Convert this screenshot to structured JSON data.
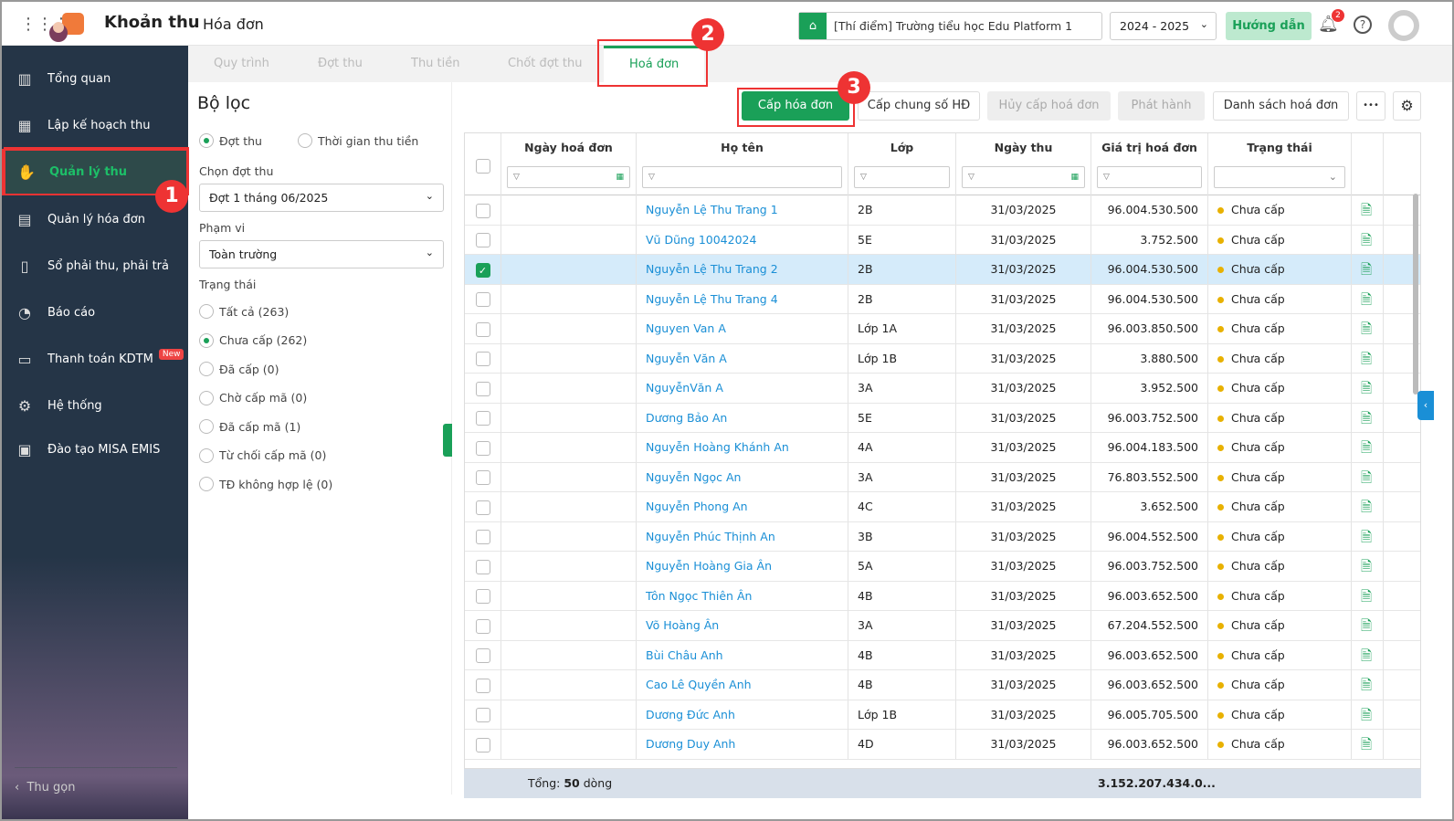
{
  "header": {
    "app_title": "Khoản thu",
    "page_title": "Hóa đơn",
    "school": "[Thí điểm] Trường tiểu học Edu Platform 1",
    "year": "2024 - 2025",
    "guide": "Hướng dẫn",
    "notif_count": "2",
    "help": "?"
  },
  "sidebar": {
    "items": [
      {
        "label": "Tổng quan",
        "icon": "chart-icon"
      },
      {
        "label": "Lập kế hoạch thu",
        "icon": "calendar-dollar-icon"
      },
      {
        "label": "Quản lý thu",
        "icon": "money-hand-icon",
        "active": true
      },
      {
        "label": "Quản lý hóa đơn",
        "icon": "invoice-icon"
      },
      {
        "label": "Sổ phải thu, phải trả",
        "icon": "ledger-icon"
      },
      {
        "label": "Báo cáo",
        "icon": "pie-chart-icon"
      },
      {
        "label": "Thanh toán KDTM",
        "icon": "card-icon",
        "badge": "New"
      },
      {
        "label": "Hệ thống",
        "icon": "gear-icon"
      },
      {
        "label": "Đào tạo MISA EMIS",
        "icon": "book-icon"
      }
    ],
    "collapse": "Thu gọn"
  },
  "callouts": [
    "1",
    "2",
    "3"
  ],
  "tabs": [
    "Quy trình",
    "Đợt thu",
    "Thu tiền",
    "Chốt đợt thu",
    "Hoá đơn"
  ],
  "filter": {
    "title": "Bộ lọc",
    "mode_options": [
      "Đợt thu",
      "Thời gian thu tiền"
    ],
    "period_label": "Chọn đợt thu",
    "period_value": "Đợt 1 tháng 06/2025",
    "scope_label": "Phạm vi",
    "scope_value": "Toàn trường",
    "status_label": "Trạng thái",
    "status_options": [
      "Tất cả (263)",
      "Chưa cấp (262)",
      "Đã cấp (0)",
      "Chờ cấp mã (0)",
      "Đã cấp mã (1)",
      "Từ chối cấp mã (0)",
      "TĐ không hợp lệ (0)"
    ],
    "status_selected": 1
  },
  "toolbar": {
    "issue": "Cấp hóa đơn",
    "issue_common": "Cấp chung số HĐ",
    "cancel": "Hủy cấp hoá đơn",
    "publish": "Phát hành",
    "list": "Danh sách hoá đơn",
    "more": "•••",
    "settings": "⚙"
  },
  "table": {
    "columns": [
      "Ngày hoá đơn",
      "Họ tên",
      "Lớp",
      "Ngày thu",
      "Giá trị hoá đơn",
      "Trạng thái"
    ],
    "rows": [
      [
        "",
        "Nguyễn Lệ Thu Trang 1",
        "2B",
        "31/03/2025",
        "96.004.530.500",
        "Chưa cấp"
      ],
      [
        "",
        "Vũ Dũng 10042024",
        "5E",
        "31/03/2025",
        "3.752.500",
        "Chưa cấp"
      ],
      [
        "",
        "Nguyễn Lệ Thu Trang 2",
        "2B",
        "31/03/2025",
        "96.004.530.500",
        "Chưa cấp"
      ],
      [
        "",
        "Nguyễn Lệ Thu Trang 4",
        "2B",
        "31/03/2025",
        "96.004.530.500",
        "Chưa cấp"
      ],
      [
        "",
        "Nguyen Van A",
        "Lớp 1A",
        "31/03/2025",
        "96.003.850.500",
        "Chưa cấp"
      ],
      [
        "",
        "Nguyễn Văn A",
        "Lớp 1B",
        "31/03/2025",
        "3.880.500",
        "Chưa cấp"
      ],
      [
        "",
        "NguyễnVăn A",
        "3A",
        "31/03/2025",
        "3.952.500",
        "Chưa cấp"
      ],
      [
        "",
        "Dương Bảo An",
        "5E",
        "31/03/2025",
        "96.003.752.500",
        "Chưa cấp"
      ],
      [
        "",
        "Nguyễn Hoàng Khánh An",
        "4A",
        "31/03/2025",
        "96.004.183.500",
        "Chưa cấp"
      ],
      [
        "",
        "Nguyễn Ngọc An",
        "3A",
        "31/03/2025",
        "76.803.552.500",
        "Chưa cấp"
      ],
      [
        "",
        "Nguyễn Phong An",
        "4C",
        "31/03/2025",
        "3.652.500",
        "Chưa cấp"
      ],
      [
        "",
        "Nguyễn Phúc Thịnh An",
        "3B",
        "31/03/2025",
        "96.004.552.500",
        "Chưa cấp"
      ],
      [
        "",
        "Nguyễn Hoàng Gia Ân",
        "5A",
        "31/03/2025",
        "96.003.752.500",
        "Chưa cấp"
      ],
      [
        "",
        "Tôn Ngọc Thiên Ân",
        "4B",
        "31/03/2025",
        "96.003.652.500",
        "Chưa cấp"
      ],
      [
        "",
        "Võ Hoàng Ân",
        "3A",
        "31/03/2025",
        "67.204.552.500",
        "Chưa cấp"
      ],
      [
        "",
        "Bùi Châu Anh",
        "4B",
        "31/03/2025",
        "96.003.652.500",
        "Chưa cấp"
      ],
      [
        "",
        "Cao Lê Quyền Anh",
        "4B",
        "31/03/2025",
        "96.003.652.500",
        "Chưa cấp"
      ],
      [
        "",
        "Dương Đức Anh",
        "Lớp 1B",
        "31/03/2025",
        "96.005.705.500",
        "Chưa cấp"
      ],
      [
        "",
        "Dương Duy Anh",
        "4D",
        "31/03/2025",
        "96.003.652.500",
        "Chưa cấp"
      ]
    ],
    "selected_row": 2,
    "footer": {
      "prefix": "Tổng: ",
      "count": "50",
      "suffix": " dòng",
      "total": "3.152.207.434.0..."
    }
  },
  "colors": {
    "accent": "#1aa058",
    "link": "#1a8fd6",
    "status_pending": "#e8b100",
    "callout": "#e33333",
    "sidebar": "#253547"
  }
}
